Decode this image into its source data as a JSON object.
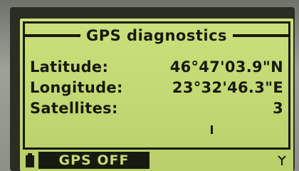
{
  "screen": {
    "title": "GPS diagnostics",
    "rows": [
      {
        "label": "Latitude:",
        "value": "46°47'03.9\"N"
      },
      {
        "label": "Longitude:",
        "value": "23°32'46.3\"E"
      },
      {
        "label": "Satellites:",
        "value": "3"
      }
    ],
    "softkey_label": "GPS OFF"
  },
  "icons": {
    "battery": "battery-icon",
    "antenna": "signal-antenna-icon"
  },
  "colors": {
    "lcd_background": "#c4da74",
    "lcd_ink": "#171a10",
    "bezel": "#2b2d22",
    "device_body": "#8b8e85"
  }
}
